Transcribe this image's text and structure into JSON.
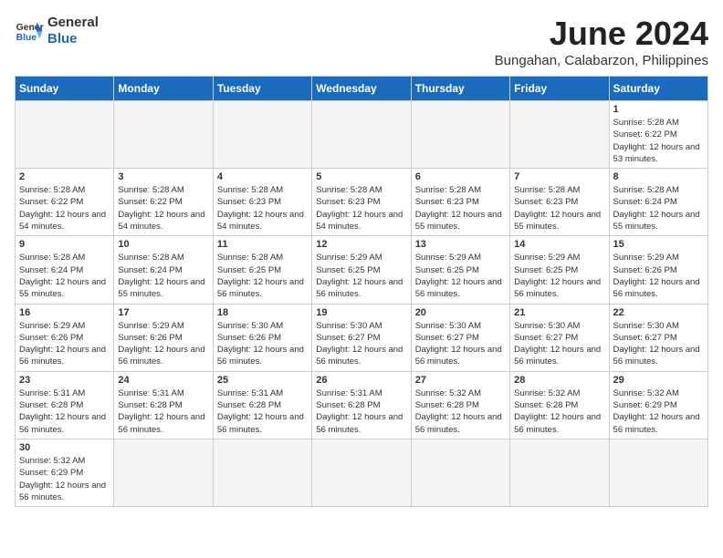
{
  "logo": {
    "text_general": "General",
    "text_blue": "Blue"
  },
  "header": {
    "title": "June 2024",
    "subtitle": "Bungahan, Calabarzon, Philippines"
  },
  "days_of_week": [
    "Sunday",
    "Monday",
    "Tuesday",
    "Wednesday",
    "Thursday",
    "Friday",
    "Saturday"
  ],
  "weeks": [
    [
      {
        "day": "",
        "empty": true
      },
      {
        "day": "",
        "empty": true
      },
      {
        "day": "",
        "empty": true
      },
      {
        "day": "",
        "empty": true
      },
      {
        "day": "",
        "empty": true
      },
      {
        "day": "",
        "empty": true
      },
      {
        "day": "1",
        "sunrise": "5:28 AM",
        "sunset": "6:22 PM",
        "daylight": "12 hours and 53 minutes."
      }
    ],
    [
      {
        "day": "2",
        "sunrise": "5:28 AM",
        "sunset": "6:22 PM",
        "daylight": "12 hours and 54 minutes."
      },
      {
        "day": "3",
        "sunrise": "5:28 AM",
        "sunset": "6:22 PM",
        "daylight": "12 hours and 54 minutes."
      },
      {
        "day": "4",
        "sunrise": "5:28 AM",
        "sunset": "6:23 PM",
        "daylight": "12 hours and 54 minutes."
      },
      {
        "day": "5",
        "sunrise": "5:28 AM",
        "sunset": "6:23 PM",
        "daylight": "12 hours and 54 minutes."
      },
      {
        "day": "6",
        "sunrise": "5:28 AM",
        "sunset": "6:23 PM",
        "daylight": "12 hours and 55 minutes."
      },
      {
        "day": "7",
        "sunrise": "5:28 AM",
        "sunset": "6:23 PM",
        "daylight": "12 hours and 55 minutes."
      },
      {
        "day": "8",
        "sunrise": "5:28 AM",
        "sunset": "6:24 PM",
        "daylight": "12 hours and 55 minutes."
      }
    ],
    [
      {
        "day": "9",
        "sunrise": "5:28 AM",
        "sunset": "6:24 PM",
        "daylight": "12 hours and 55 minutes."
      },
      {
        "day": "10",
        "sunrise": "5:28 AM",
        "sunset": "6:24 PM",
        "daylight": "12 hours and 55 minutes."
      },
      {
        "day": "11",
        "sunrise": "5:28 AM",
        "sunset": "6:25 PM",
        "daylight": "12 hours and 56 minutes."
      },
      {
        "day": "12",
        "sunrise": "5:29 AM",
        "sunset": "6:25 PM",
        "daylight": "12 hours and 56 minutes."
      },
      {
        "day": "13",
        "sunrise": "5:29 AM",
        "sunset": "6:25 PM",
        "daylight": "12 hours and 56 minutes."
      },
      {
        "day": "14",
        "sunrise": "5:29 AM",
        "sunset": "6:25 PM",
        "daylight": "12 hours and 56 minutes."
      },
      {
        "day": "15",
        "sunrise": "5:29 AM",
        "sunset": "6:26 PM",
        "daylight": "12 hours and 56 minutes."
      }
    ],
    [
      {
        "day": "16",
        "sunrise": "5:29 AM",
        "sunset": "6:26 PM",
        "daylight": "12 hours and 56 minutes."
      },
      {
        "day": "17",
        "sunrise": "5:29 AM",
        "sunset": "6:26 PM",
        "daylight": "12 hours and 56 minutes."
      },
      {
        "day": "18",
        "sunrise": "5:30 AM",
        "sunset": "6:26 PM",
        "daylight": "12 hours and 56 minutes."
      },
      {
        "day": "19",
        "sunrise": "5:30 AM",
        "sunset": "6:27 PM",
        "daylight": "12 hours and 56 minutes."
      },
      {
        "day": "20",
        "sunrise": "5:30 AM",
        "sunset": "6:27 PM",
        "daylight": "12 hours and 56 minutes."
      },
      {
        "day": "21",
        "sunrise": "5:30 AM",
        "sunset": "6:27 PM",
        "daylight": "12 hours and 56 minutes."
      },
      {
        "day": "22",
        "sunrise": "5:30 AM",
        "sunset": "6:27 PM",
        "daylight": "12 hours and 56 minutes."
      }
    ],
    [
      {
        "day": "23",
        "sunrise": "5:31 AM",
        "sunset": "6:28 PM",
        "daylight": "12 hours and 56 minutes."
      },
      {
        "day": "24",
        "sunrise": "5:31 AM",
        "sunset": "6:28 PM",
        "daylight": "12 hours and 56 minutes."
      },
      {
        "day": "25",
        "sunrise": "5:31 AM",
        "sunset": "6:28 PM",
        "daylight": "12 hours and 56 minutes."
      },
      {
        "day": "26",
        "sunrise": "5:31 AM",
        "sunset": "6:28 PM",
        "daylight": "12 hours and 56 minutes."
      },
      {
        "day": "27",
        "sunrise": "5:32 AM",
        "sunset": "6:28 PM",
        "daylight": "12 hours and 56 minutes."
      },
      {
        "day": "28",
        "sunrise": "5:32 AM",
        "sunset": "6:28 PM",
        "daylight": "12 hours and 56 minutes."
      },
      {
        "day": "29",
        "sunrise": "5:32 AM",
        "sunset": "6:29 PM",
        "daylight": "12 hours and 56 minutes."
      }
    ],
    [
      {
        "day": "30",
        "sunrise": "5:32 AM",
        "sunset": "6:29 PM",
        "daylight": "12 hours and 56 minutes."
      },
      {
        "day": "",
        "empty": true
      },
      {
        "day": "",
        "empty": true
      },
      {
        "day": "",
        "empty": true
      },
      {
        "day": "",
        "empty": true
      },
      {
        "day": "",
        "empty": true
      },
      {
        "day": "",
        "empty": true
      }
    ]
  ]
}
